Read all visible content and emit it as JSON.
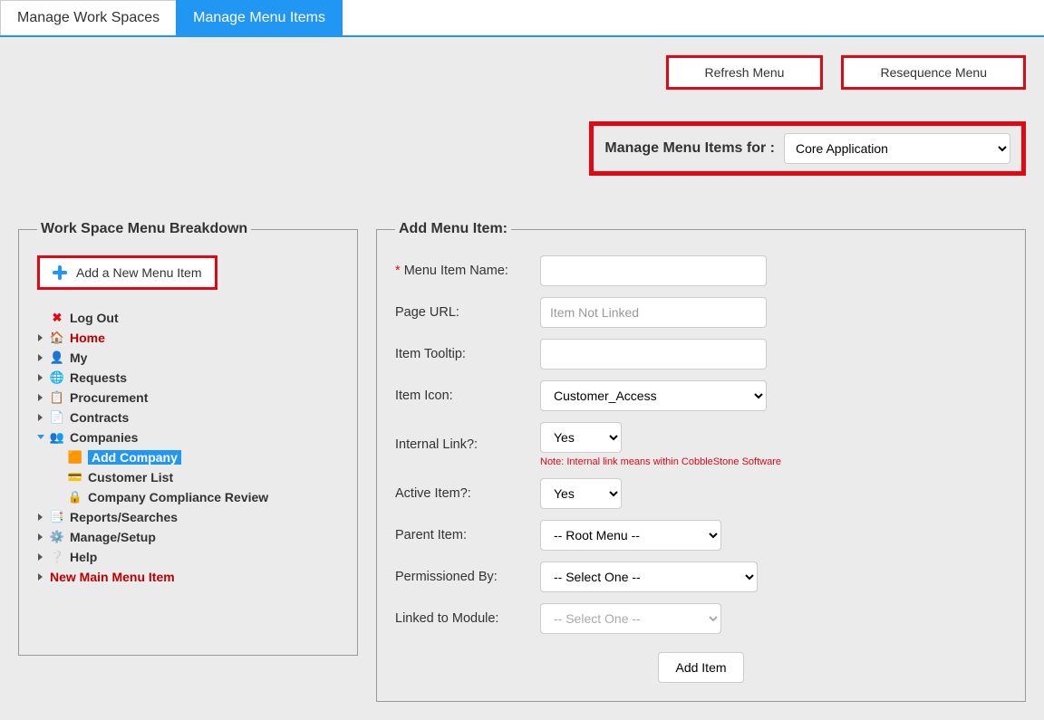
{
  "tabs": {
    "workspaces": "Manage Work Spaces",
    "menuitems": "Manage Menu Items"
  },
  "actions": {
    "refresh": "Refresh Menu",
    "resequence": "Resequence Menu"
  },
  "selector": {
    "label": "Manage Menu Items for :",
    "value": "Core Application"
  },
  "left": {
    "legend": "Work Space Menu Breakdown",
    "add_new": "Add a New Menu Item",
    "tree": {
      "logout": "Log Out",
      "home": "Home",
      "my": "My",
      "requests": "Requests",
      "procurement": "Procurement",
      "contracts": "Contracts",
      "companies": "Companies",
      "companies_children": {
        "add": "Add Company",
        "list": "Customer List",
        "compliance": "Company Compliance Review"
      },
      "reports": "Reports/Searches",
      "manage": "Manage/Setup",
      "help": "Help",
      "new_main": "New Main Menu Item"
    }
  },
  "right": {
    "legend": "Add Menu Item:",
    "labels": {
      "name": "Menu Item Name:",
      "url": "Page URL:",
      "tooltip": "Item Tooltip:",
      "icon": "Item Icon:",
      "internal": "Internal Link?:",
      "active": "Active Item?:",
      "parent": "Parent Item:",
      "permission": "Permissioned By:",
      "module": "Linked to Module:"
    },
    "url_placeholder": "Item Not Linked",
    "icon_value": "Customer_Access",
    "internal_value": "Yes",
    "internal_note": "Note: Internal link means within CobbleStone Software",
    "active_value": "Yes",
    "parent_value": "-- Root Menu --",
    "permission_value": "-- Select One --",
    "module_value": "-- Select One --",
    "submit": "Add Item"
  }
}
